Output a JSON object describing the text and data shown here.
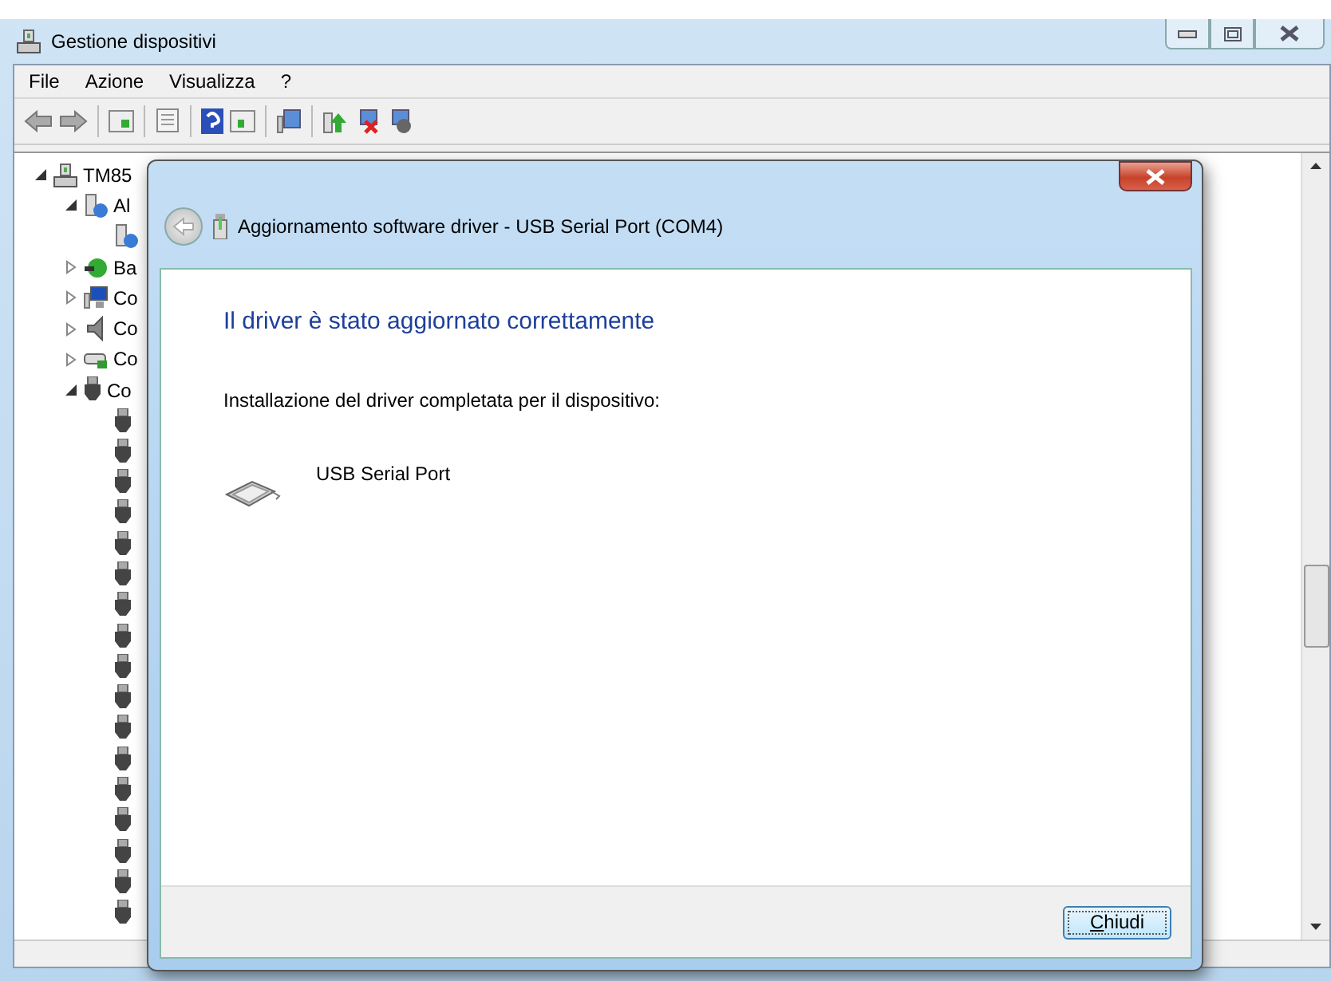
{
  "window": {
    "title": "Gestione dispositivi"
  },
  "menu": [
    "File",
    "Azione",
    "Visualizza",
    "?"
  ],
  "tree": [
    {
      "label": "TM85",
      "kind": "computer",
      "expanded": true,
      "children": [
        {
          "label": "Al",
          "kind": "unknown",
          "expanded": true,
          "children": [
            {
              "kind": "unknown"
            }
          ]
        },
        {
          "label": "Ba",
          "kind": "battery",
          "expanded": false
        },
        {
          "label": "Co",
          "kind": "monitor",
          "expanded": false
        },
        {
          "label": "Co",
          "kind": "speaker",
          "expanded": false
        },
        {
          "label": "Co",
          "kind": "card",
          "expanded": false
        },
        {
          "label": "Co",
          "kind": "usb",
          "expanded": true,
          "children": [
            {
              "kind": "usb"
            },
            {
              "kind": "usb"
            },
            {
              "kind": "usb"
            },
            {
              "kind": "usb"
            },
            {
              "kind": "usb"
            },
            {
              "kind": "usb"
            },
            {
              "kind": "usb"
            },
            {
              "kind": "usb"
            },
            {
              "kind": "usb"
            },
            {
              "kind": "usb"
            },
            {
              "kind": "usb"
            },
            {
              "kind": "usb"
            },
            {
              "kind": "usb"
            },
            {
              "kind": "usb"
            },
            {
              "kind": "usb"
            },
            {
              "kind": "usb"
            },
            {
              "kind": "usb"
            }
          ]
        }
      ]
    }
  ],
  "dialog": {
    "title": "Aggiornamento software driver - USB Serial Port (COM4)",
    "heading": "Il driver è stato aggiornato correttamente",
    "message": "Installazione del driver completata per il dispositivo:",
    "device": "USB Serial Port",
    "close_button": {
      "mnemonic": "C",
      "rest": "hiudi"
    }
  }
}
